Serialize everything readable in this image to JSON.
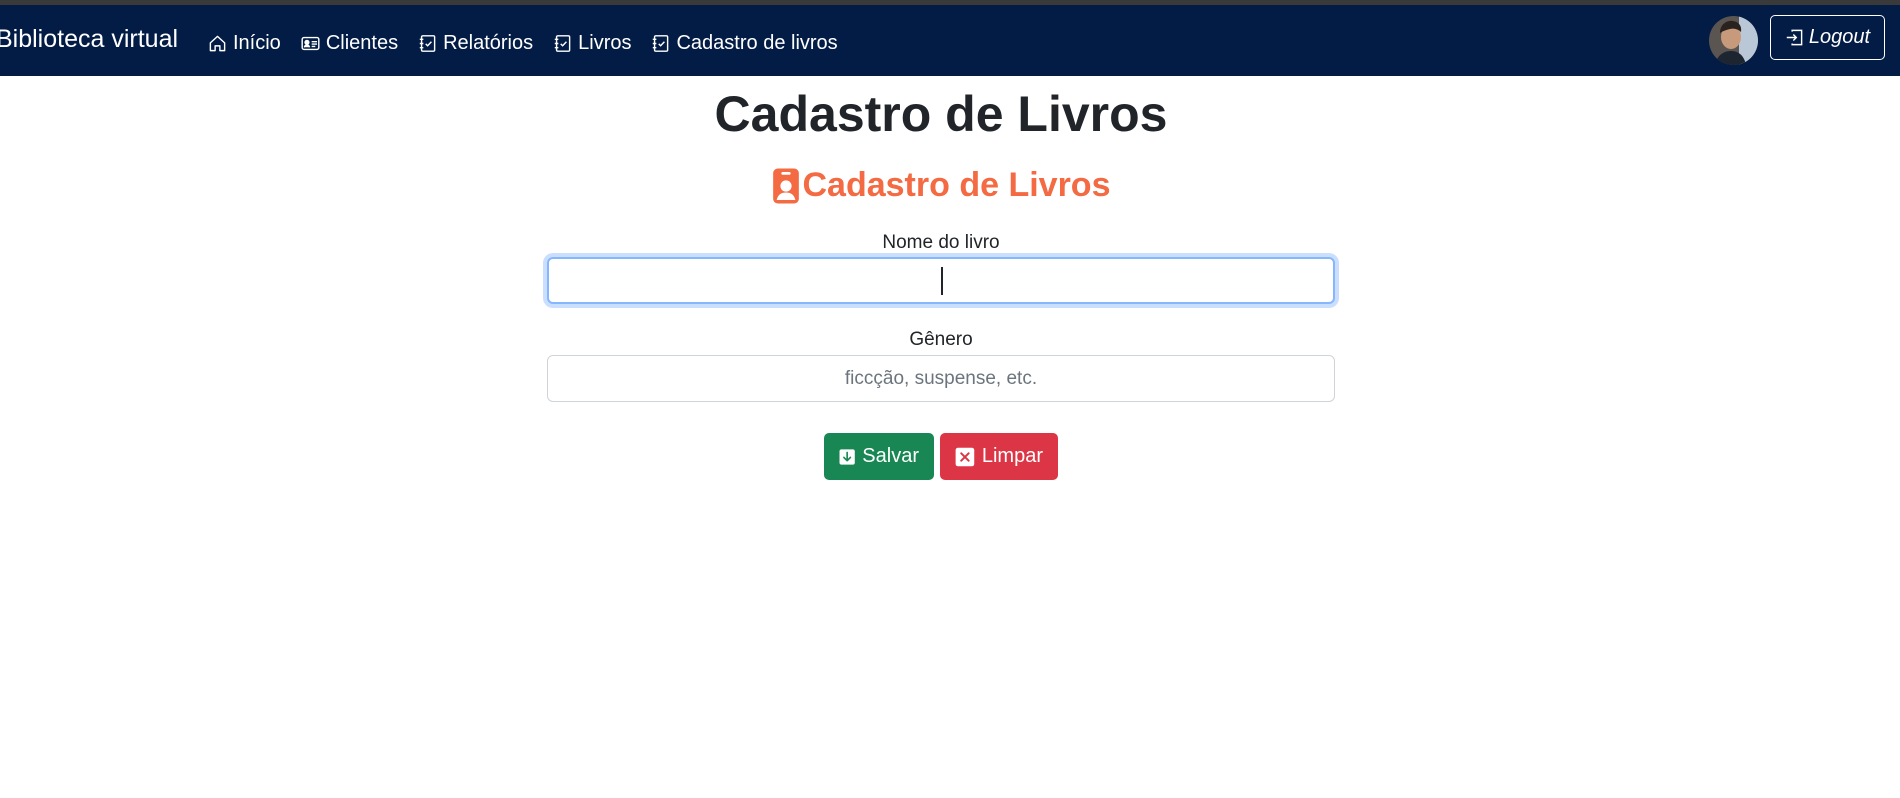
{
  "navbar": {
    "brand": "Biblioteca virtual",
    "items": [
      {
        "label": "Início",
        "icon": "house-icon"
      },
      {
        "label": "Clientes",
        "icon": "person-vcard-icon"
      },
      {
        "label": "Relatórios",
        "icon": "journal-check-icon"
      },
      {
        "label": "Livros",
        "icon": "journal-check-icon"
      },
      {
        "label": "Cadastro de livros",
        "icon": "journal-check-icon"
      }
    ],
    "logout_label": "Logout",
    "background": "#031c45"
  },
  "page": {
    "title": "Cadastro de Livros",
    "section_title": "Cadastro de Livros",
    "section_color": "#f36a43"
  },
  "form": {
    "book_name": {
      "label": "Nome do livro",
      "value": "",
      "placeholder": ""
    },
    "genre": {
      "label": "Gênero",
      "value": "",
      "placeholder": "ficcção, suspense, etc."
    }
  },
  "buttons": {
    "save_label": "Salvar",
    "clear_label": "Limpar",
    "save_color": "#198754",
    "clear_color": "#dc3545"
  }
}
